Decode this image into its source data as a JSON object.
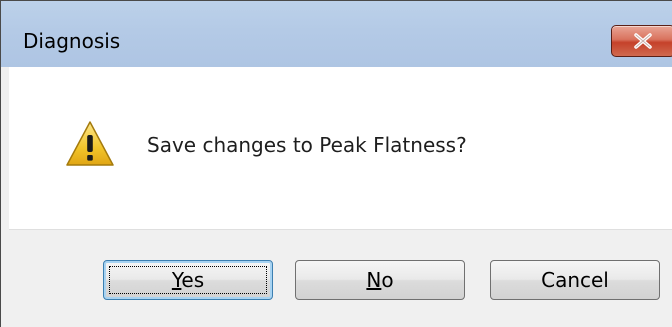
{
  "window": {
    "title": "Diagnosis"
  },
  "titlebar": {
    "close_icon": "close-x-icon"
  },
  "message": {
    "icon": "warning-icon",
    "text": "Save changes to Peak Flatness?"
  },
  "buttons": {
    "yes": {
      "mnemonic": "Y",
      "rest": "es",
      "label": "Yes"
    },
    "no": {
      "mnemonic": "N",
      "rest": "o",
      "label": "No"
    },
    "cancel": {
      "label": "Cancel"
    }
  },
  "colors": {
    "titlebar": "#b4cae6",
    "close_button": "#c5412a",
    "warning_fill": "#f2c52b",
    "default_button_border": "#3c7fb1"
  }
}
